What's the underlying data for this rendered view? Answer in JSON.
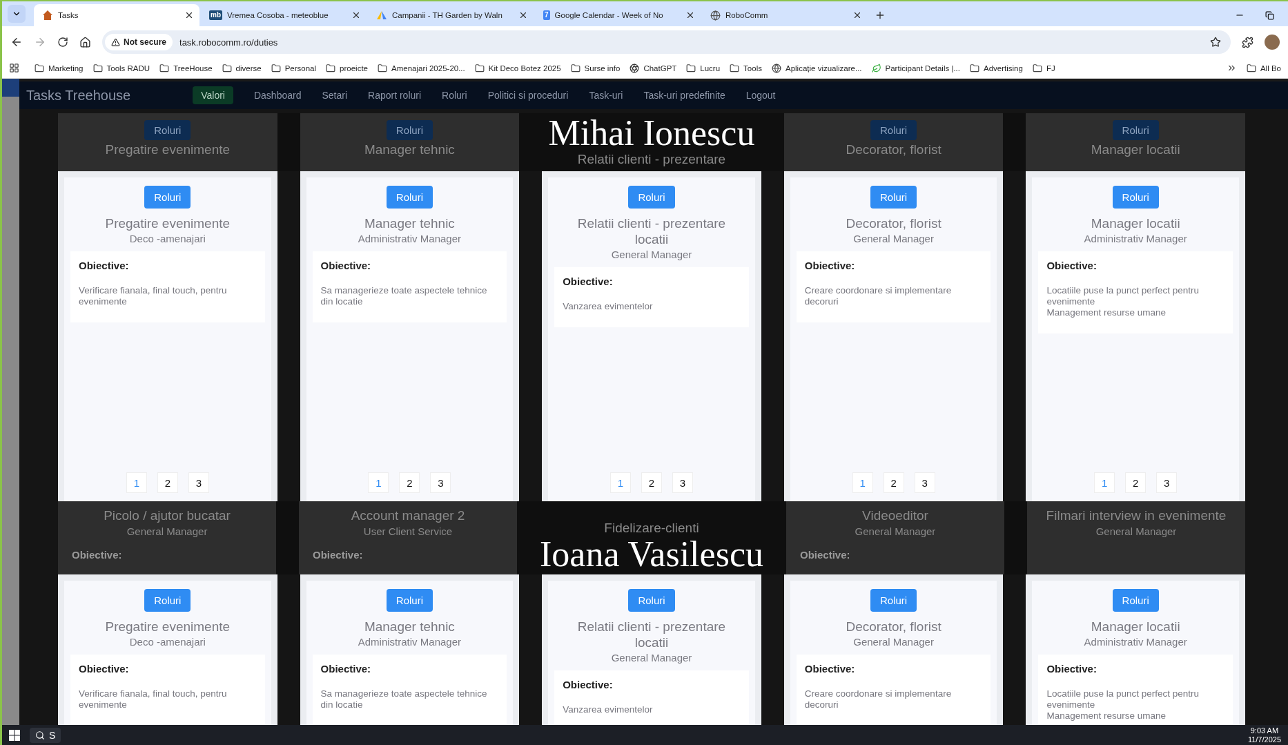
{
  "browser": {
    "tabs": [
      {
        "title": "Tasks",
        "selected": true,
        "kind": "house"
      },
      {
        "title": "Vremea Cosoba - meteoblue",
        "selected": false,
        "kind": "text",
        "badge": "mb"
      },
      {
        "title": "Campanii - TH Garden by Waln",
        "selected": false,
        "kind": "triangle"
      },
      {
        "title": "Google Calendar - Week of No",
        "selected": false,
        "kind": "calendar",
        "badge": "7"
      },
      {
        "title": "RoboComm",
        "selected": false,
        "kind": "globe"
      }
    ],
    "security": "Not secure",
    "url": "task.robocomm.ro/duties",
    "bookmarks": [
      {
        "label": "Marketing",
        "kind": "folder"
      },
      {
        "label": "Tools RADU",
        "kind": "folder"
      },
      {
        "label": "TreeHouse",
        "kind": "folder"
      },
      {
        "label": "diverse",
        "kind": "folder"
      },
      {
        "label": "Personal",
        "kind": "folder"
      },
      {
        "label": "proeicte",
        "kind": "folder"
      },
      {
        "label": "Amenajari 2025-20...",
        "kind": "folder"
      },
      {
        "label": "Kit Deco Botez 2025",
        "kind": "folder"
      },
      {
        "label": "Surse info",
        "kind": "folder"
      },
      {
        "label": "ChatGPT",
        "kind": "swirl"
      },
      {
        "label": "Lucru",
        "kind": "folder"
      },
      {
        "label": "Tools",
        "kind": "folder"
      },
      {
        "label": "Aplicație vizualizare...",
        "kind": "globe"
      },
      {
        "label": "Participant Details |...",
        "kind": "leaf"
      },
      {
        "label": "Advertising",
        "kind": "folder"
      },
      {
        "label": "FJ",
        "kind": "folder"
      }
    ],
    "all_bookmarks": "All Bo"
  },
  "nav": {
    "brand": "Tasks Treehouse",
    "items": [
      {
        "label": "Valori",
        "kind": "button"
      },
      {
        "label": "Dashboard",
        "kind": "link"
      },
      {
        "label": "Setari",
        "kind": "link"
      },
      {
        "label": "Raport roluri",
        "kind": "link"
      },
      {
        "label": "Roluri",
        "kind": "link"
      },
      {
        "label": "Politici si proceduri",
        "kind": "link"
      },
      {
        "label": "Task-uri",
        "kind": "link"
      },
      {
        "label": "Task-uri predefinite",
        "kind": "link"
      },
      {
        "label": "Logout",
        "kind": "link"
      }
    ]
  },
  "sections": [
    {
      "kind": "ghost-band",
      "left": [
        {
          "button": "Roluri",
          "title": "Pregatire evenimente"
        },
        {
          "button": "Roluri",
          "title": "Manager tehnic"
        }
      ],
      "center": [
        {
          "kind": "heading",
          "text": "Mihai Ionescu"
        },
        {
          "kind": "ghost-title",
          "text": "Relatii clienti - prezentare"
        }
      ],
      "right": [
        {
          "button": "Roluri",
          "title": "Decorator, florist"
        },
        {
          "button": "Roluri",
          "title": "Manager locatii"
        }
      ]
    },
    {
      "kind": "card-row",
      "cards": [
        {
          "button": "Roluri",
          "title": "Pregatire evenimente",
          "subtitle": "Deco -amenajari",
          "label": "Obiective:",
          "objectives": [
            "Verificare fianala, final touch, pentru evenimente"
          ],
          "pages": [
            {
              "label": "1",
              "selected": true
            },
            {
              "label": "2",
              "selected": false
            },
            {
              "label": "3",
              "selected": false
            }
          ]
        },
        {
          "button": "Roluri",
          "title": "Manager tehnic",
          "subtitle": "Administrativ Manager",
          "label": "Obiective:",
          "objectives": [
            "Sa managerieze toate aspectele tehnice din locatie"
          ],
          "pages": [
            {
              "label": "1",
              "selected": true
            },
            {
              "label": "2",
              "selected": false
            },
            {
              "label": "3",
              "selected": false
            }
          ]
        },
        {
          "button": "Roluri",
          "title": "Relatii clienti - prezentare locatii",
          "subtitle": "General Manager",
          "label": "Obiective:",
          "objectives": [
            "Vanzarea evimentelor"
          ],
          "pages": [
            {
              "label": "1",
              "selected": true
            },
            {
              "label": "2",
              "selected": false
            },
            {
              "label": "3",
              "selected": false
            }
          ]
        },
        {
          "button": "Roluri",
          "title": "Decorator, florist",
          "subtitle": "General Manager",
          "label": "Obiective:",
          "objectives": [
            "Creare coordonare si implementare decoruri"
          ],
          "pages": [
            {
              "label": "1",
              "selected": true
            },
            {
              "label": "2",
              "selected": false
            },
            {
              "label": "3",
              "selected": false
            }
          ]
        },
        {
          "button": "Roluri",
          "title": "Manager locatii",
          "subtitle": "Administrativ Manager",
          "label": "Obiective:",
          "objectives": [
            "Locatiile puse la punct perfect pentru evenimente",
            "Management resurse umane"
          ],
          "pages": [
            {
              "label": "1",
              "selected": true
            },
            {
              "label": "2",
              "selected": false
            },
            {
              "label": "3",
              "selected": false
            }
          ]
        }
      ]
    },
    {
      "kind": "ghost-band",
      "left": [
        {
          "title": "Picolo / ajutor bucatar",
          "subtitle": "General Manager",
          "label": "Obiective:"
        },
        {
          "title": "Account manager 2",
          "subtitle": "User Client Service",
          "label": "Obiective:"
        }
      ],
      "center": [
        {
          "kind": "ghost-title",
          "text": "Fidelizare-clienti"
        },
        {
          "kind": "heading",
          "text": "Ioana Vasilescu"
        }
      ],
      "right": [
        {
          "title": "Videoeditor",
          "subtitle": "General Manager",
          "label": "Obiective:"
        },
        {
          "title": "Filmari interview in evenimente",
          "subtitle": "General Manager"
        }
      ]
    },
    {
      "kind": "card-row",
      "cards": [
        {
          "button": "Roluri",
          "title": "Pregatire evenimente",
          "subtitle": "Deco -amenajari",
          "label": "Obiective:",
          "objectives": [
            "Verificare fianala, final touch, pentru evenimente"
          ]
        },
        {
          "button": "Roluri",
          "title": "Manager tehnic",
          "subtitle": "Administrativ Manager",
          "label": "Obiective:",
          "objectives": [
            "Sa managerieze toate aspectele tehnice din locatie"
          ]
        },
        {
          "button": "Roluri",
          "title": "Relatii clienti - prezentare locatii",
          "subtitle": "General Manager",
          "label": "Obiective:",
          "objectives": [
            "Vanzarea evimentelor"
          ]
        },
        {
          "button": "Roluri",
          "title": "Decorator, florist",
          "subtitle": "General Manager",
          "label": "Obiective:",
          "objectives": [
            "Creare coordonare si implementare decoruri"
          ]
        },
        {
          "button": "Roluri",
          "title": "Manager locatii",
          "subtitle": "Administrativ Manager",
          "label": "Obiective:",
          "objectives": [
            "Locatiile puse la punct perfect pentru evenimente",
            "Management resurse umane"
          ]
        }
      ]
    }
  ],
  "taskbar": {
    "search": "S",
    "time": "9:03 AM",
    "date": "11/7/2025"
  }
}
